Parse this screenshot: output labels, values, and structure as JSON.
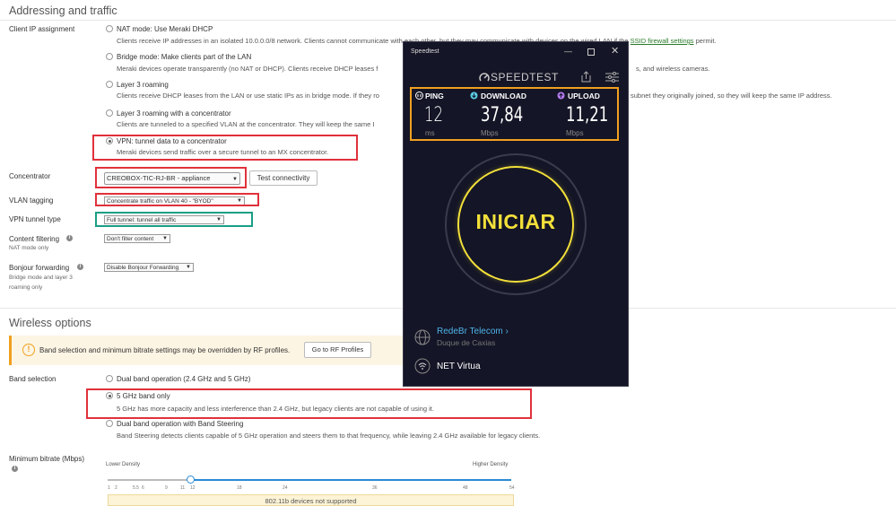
{
  "addressing": {
    "heading": "Addressing and traffic",
    "client_ip_label": "Client IP assignment",
    "options": [
      {
        "title": "NAT mode: Use Meraki DHCP",
        "desc": "Clients receive IP addresses in an isolated 10.0.0.0/8 network. Clients cannot communicate with each other, but they may communicate with devices on the wired LAN if the",
        "link": "SSID firewall settings",
        "desc_after": " permit."
      },
      {
        "title": "Bridge mode: Make clients part of the LAN",
        "desc": "Meraki devices operate transparently (no NAT or DHCP). Clients receive DHCP leases f",
        "desc_tail": "s, and wireless cameras."
      },
      {
        "title": "Layer 3 roaming",
        "desc": "Clients receive DHCP leases from the LAN or use static IPs as in bridge mode. If they ro",
        "desc_tail": "subnet they originally joined, so they will keep the same IP address."
      },
      {
        "title": "Layer 3 roaming with a concentrator",
        "desc": "Clients are tunneled to a specified VLAN at the concentrator. They will keep the same I"
      },
      {
        "title": "VPN: tunnel data to a concentrator",
        "desc": "Meraki devices send traffic over a secure tunnel to an MX concentrator."
      }
    ],
    "concentrator_label": "Concentrator",
    "concentrator_value": "CREOBOX-TIC-RJ-BR - appliance",
    "test_button": "Test connectivity",
    "vlan_label": "VLAN tagging",
    "vlan_value": "Concentrate traffic on VLAN 40 - \"BYOD\"",
    "vpn_label": "VPN tunnel type",
    "vpn_value": "Full tunnel: tunnel all traffic",
    "content_label": "Content filtering",
    "content_sub": "NAT mode only",
    "content_value": "Don't filter content",
    "bonjour_label": "Bonjour forwarding",
    "bonjour_sub1": "Bridge mode and layer 3",
    "bonjour_sub2": "roaming only",
    "bonjour_value": "Disable Bonjour Forwarding"
  },
  "wireless": {
    "heading": "Wireless options",
    "alert_text": "Band selection and minimum bitrate settings may be overridden by RF profiles.",
    "rf_button": "Go to RF Profiles",
    "band_label": "Band selection",
    "band_options": [
      {
        "title": "Dual band operation (2.4 GHz and 5 GHz)",
        "desc": ""
      },
      {
        "title": "5 GHz band only",
        "desc": "5 GHz has more capacity and less interference than 2.4 GHz, but legacy clients are not capable of using it."
      },
      {
        "title": "Dual band operation with Band Steering",
        "desc": "Band Steering detects clients capable of 5 GHz operation and steers them to that frequency, while leaving 2.4 GHz available for legacy clients."
      }
    ],
    "bitrate_label": "Minimum bitrate (Mbps)",
    "lower": "Lower Density",
    "higher": "Higher Density",
    "ticks": [
      "1",
      "2",
      "5.5",
      "6",
      "9",
      "11",
      "12",
      "18",
      "24",
      "36",
      "48",
      "54"
    ],
    "bitrate_value": 12,
    "note": "802.11b devices not supported"
  },
  "speedtest": {
    "window_title": "Speedtest",
    "logo": "SPEEDTEST",
    "ping_label": "PING",
    "download_label": "DOWNLOAD",
    "upload_label": "UPLOAD",
    "ping_value": "12",
    "download_value": "37,84",
    "upload_value": "11,21",
    "ping_unit": "ms",
    "download_unit": "Mbps",
    "upload_unit": "Mbps",
    "go_label": "INICIAR",
    "isp": "RedeBr Telecom",
    "isp_arrow": "›",
    "location": "Duque de Caxias",
    "network": "NET Virtua",
    "accent_yellow": "#f3e03a",
    "accent_orange": "#f0a020"
  }
}
